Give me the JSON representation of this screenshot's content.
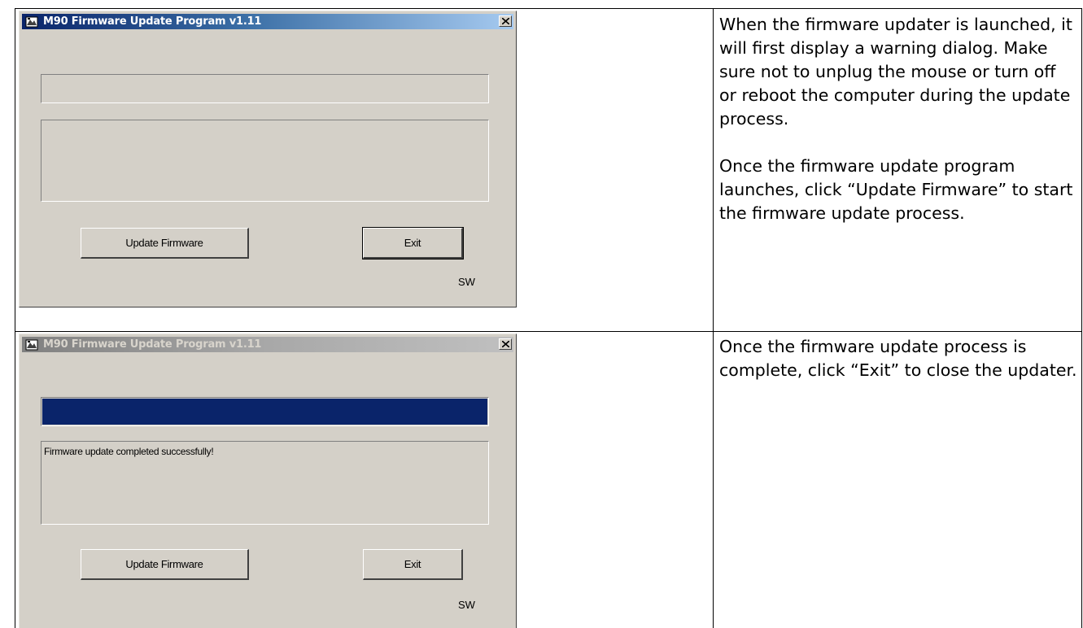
{
  "rows": [
    {
      "dialog": {
        "title": "M90 Firmware Update Program v1.11",
        "title_state": "active",
        "progress": 0,
        "status_text": "",
        "update_button": "Update Firmware",
        "exit_button": "Exit",
        "version_tag": "SW"
      },
      "description": [
        "When the firmware updater is launched, it will first display a warning dialog.  Make sure not to unplug the mouse or turn off or reboot the computer during the update process.",
        "Once the firmware update program launches, click “Update Firmware” to start the firmware update process."
      ]
    },
    {
      "dialog": {
        "title": "M90 Firmware Update Program v1.11",
        "title_state": "inactive",
        "progress": 1.0,
        "status_text": "Firmware update completed successfully!",
        "update_button": "Update Firmware",
        "exit_button": "Exit",
        "version_tag": "SW"
      },
      "description": [
        "Once the firmware update process is complete, click “Exit” to close the updater."
      ]
    }
  ],
  "colors": {
    "dialog_face": "#d4d0c8",
    "title_active": "#0a246a",
    "title_inactive": "#808080",
    "progress": "#0a246a"
  },
  "icons": [
    "app-icon",
    "close-icon"
  ]
}
